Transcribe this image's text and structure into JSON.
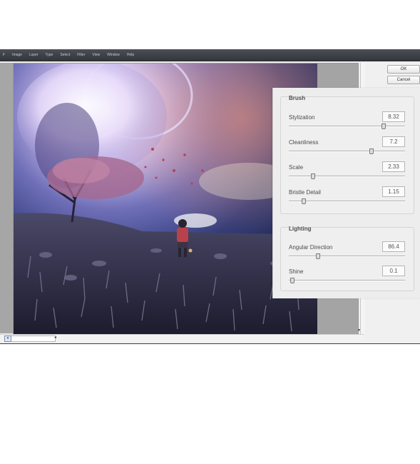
{
  "menubar": {
    "items": [
      "F",
      "Image",
      "Layer",
      "Type",
      "Select",
      "Filter",
      "View",
      "Window",
      "Help"
    ]
  },
  "dialog": {
    "ok_label": "OK",
    "cancel_label": "Cancel"
  },
  "panel": {
    "brush": {
      "title": "Brush",
      "params": [
        {
          "label": "Stylization",
          "value": "8.32",
          "level": 0.83
        },
        {
          "label": "Cleanliness",
          "value": "7.2",
          "level": 0.72
        },
        {
          "label": "Scale",
          "value": "2.33",
          "level": 0.2
        },
        {
          "label": "Bristle Detail",
          "value": "1.15",
          "level": 0.115
        }
      ]
    },
    "lighting": {
      "title": "Lighting",
      "params": [
        {
          "label": "Angular Direction",
          "value": "86.4",
          "level": 0.24
        },
        {
          "label": "Shine",
          "value": "0.1",
          "level": 0.01
        }
      ]
    }
  },
  "icons": {
    "zoom": "zoom-dropdown-icon",
    "scroll": "scroll-arrow-icon"
  }
}
